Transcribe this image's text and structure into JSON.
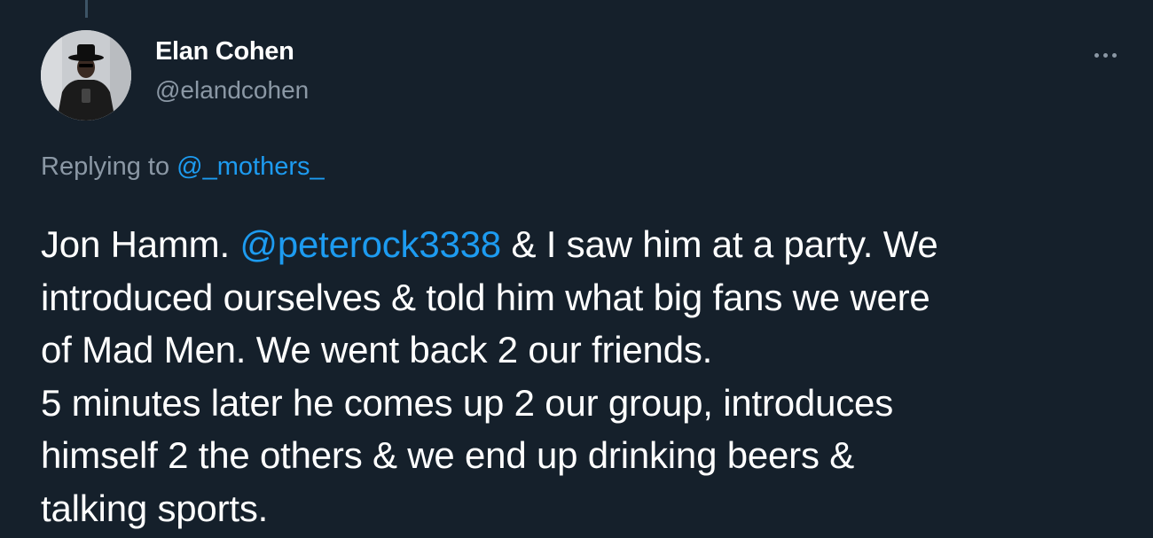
{
  "tweet": {
    "author": {
      "name": "Elan Cohen",
      "handle": "@elandcohen"
    },
    "more_icon": "more-horizontal-icon",
    "replying": {
      "prefix": "Replying to",
      "mention": "@_mothers_"
    },
    "text": {
      "line1_prefix": "Jon Hamm.",
      "line1_mention": "@peterock3338",
      "line1_suffix": "& I saw him at a party. We",
      "line2": "introduced ourselves & told him what big fans we were",
      "line3": "of Mad Men. We went back 2 our friends.",
      "line4": "5 minutes later he comes up 2 our group, introduces",
      "line5": "himself 2 the others & we end up drinking beers &",
      "line6": "talking sports."
    }
  },
  "colors": {
    "background": "#15202b",
    "text_primary": "#ffffff",
    "text_secondary": "#8b98a5",
    "accent": "#1d9bf0"
  }
}
